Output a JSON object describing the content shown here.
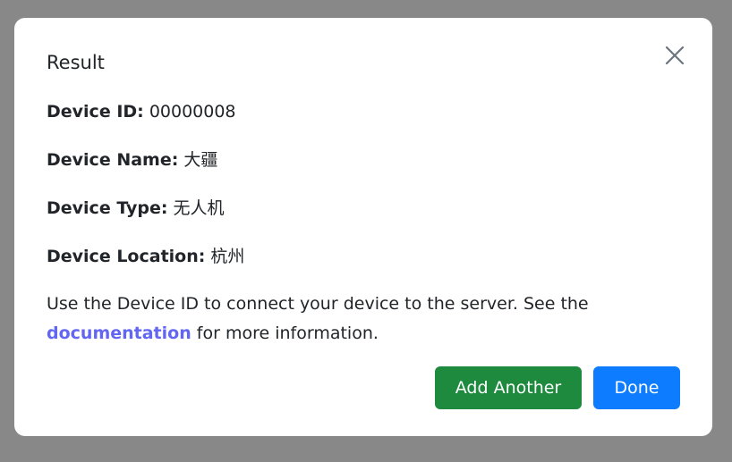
{
  "dialog": {
    "title": "Result",
    "close_icon": "close-icon"
  },
  "fields": [
    {
      "label": "Device ID:",
      "value": "00000008"
    },
    {
      "label": "Device Name:",
      "value": "大疆"
    },
    {
      "label": "Device Type:",
      "value": "无人机"
    },
    {
      "label": "Device Location:",
      "value": "杭州"
    }
  ],
  "info": {
    "text_before": "Use the Device ID to connect your device to the server. See the",
    "link": "documentation",
    "text_after": "for more information."
  },
  "buttons": {
    "add_another": "Add Another",
    "done": "Done"
  },
  "colors": {
    "overlay": "#888888",
    "link": "#6366f1",
    "add_button": "#1e8a3e",
    "done_button": "#0d7cff"
  }
}
